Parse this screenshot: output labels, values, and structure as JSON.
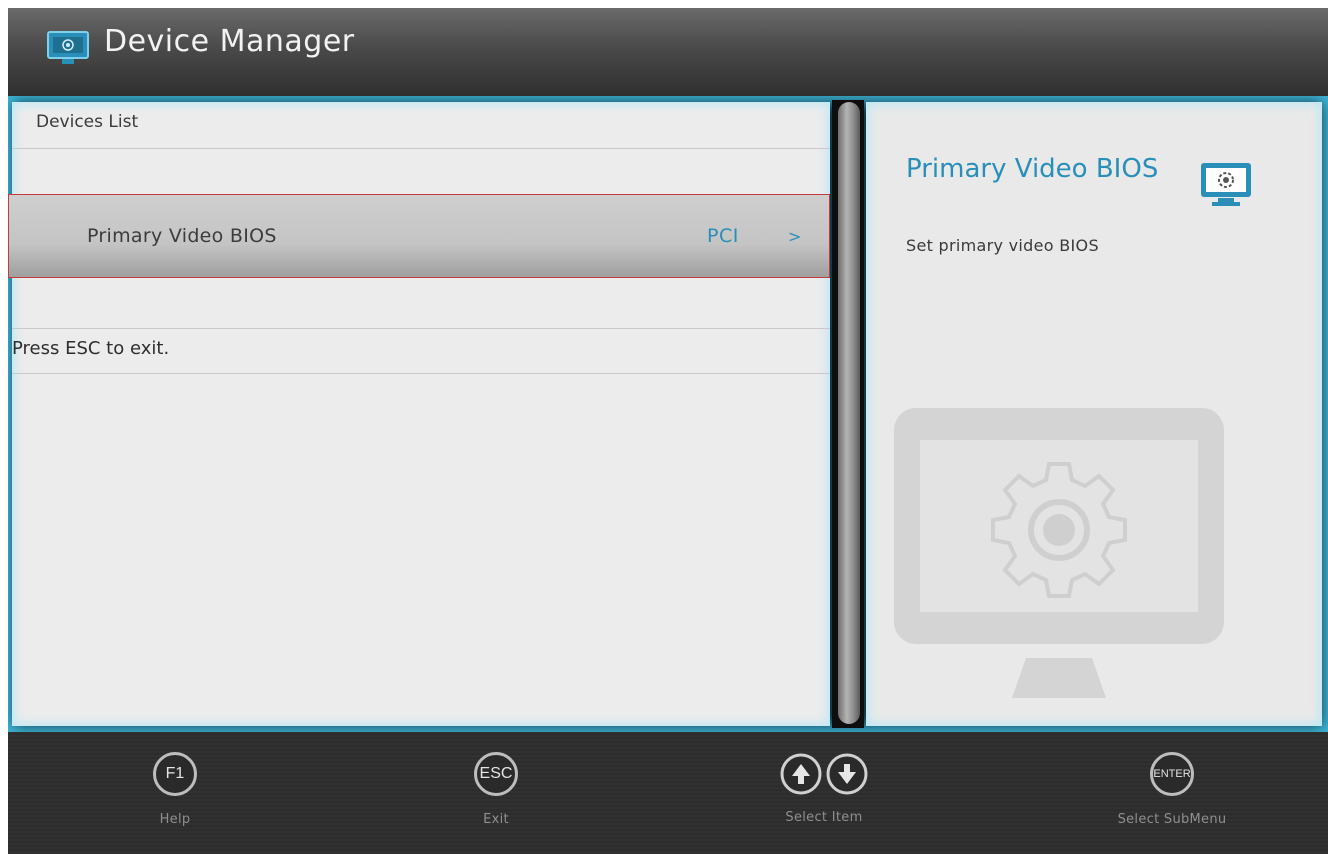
{
  "header": {
    "title": "Device Manager",
    "icon": "monitor-gear-icon"
  },
  "left_panel": {
    "section_title": "Devices List",
    "items": [
      {
        "label": "Primary Video BIOS",
        "value": "PCI",
        "arrow": ">"
      }
    ],
    "hint": "Press ESC to exit."
  },
  "right_panel": {
    "title": "Primary Video BIOS",
    "description": "Set primary video BIOS",
    "icon": "monitor-gear-icon"
  },
  "footer": {
    "keys": [
      {
        "key": "F1",
        "label": "Help"
      },
      {
        "key": "ESC",
        "label": "Exit"
      },
      {
        "key": "↑↓",
        "label": "Select Item"
      },
      {
        "key": "ENTER",
        "label": "Select  SubMenu"
      }
    ]
  },
  "colors": {
    "accent": "#2a8fb8",
    "glow": "#3fb6d6",
    "selection_border": "#c83a3a"
  }
}
